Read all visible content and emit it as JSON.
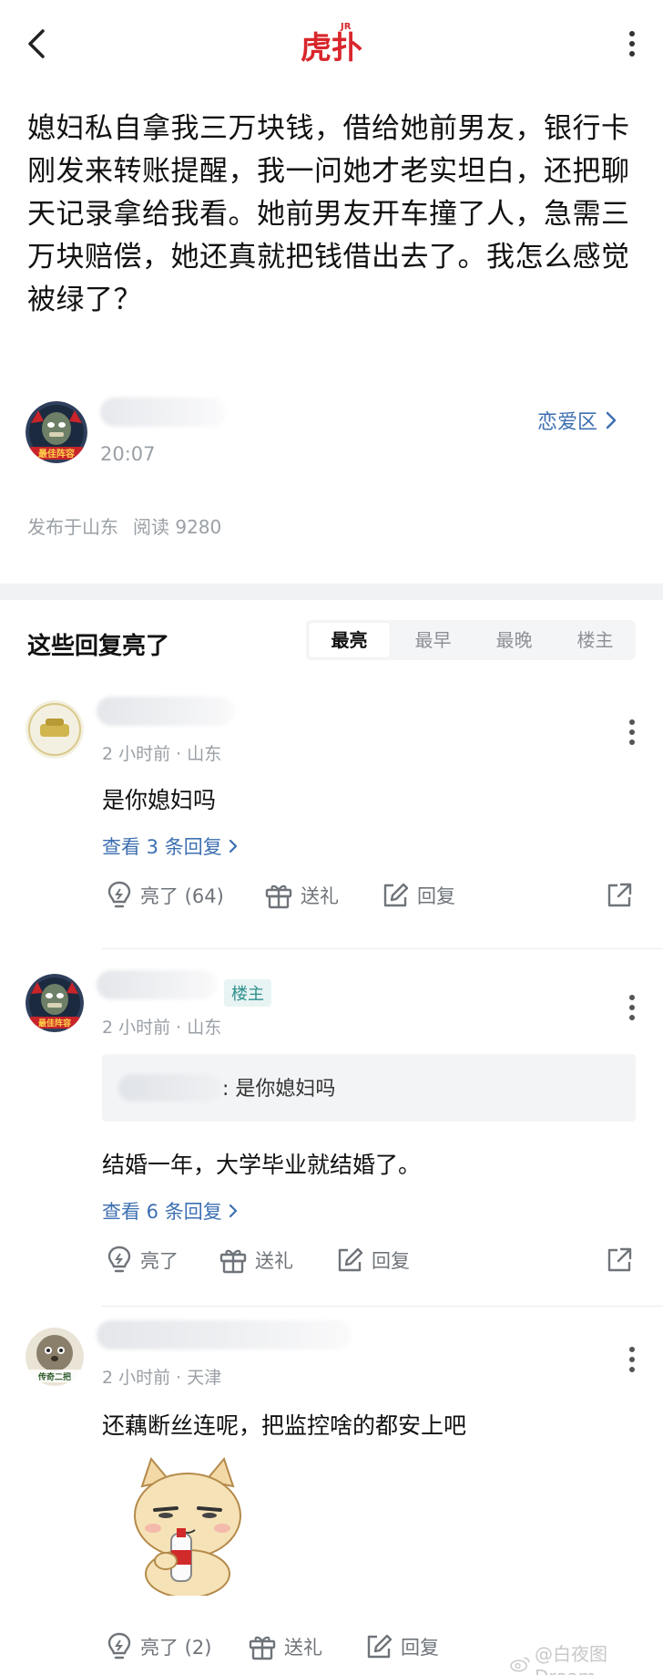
{
  "app": {
    "logo_text": "虎扑",
    "logo_badge": "JR"
  },
  "post": {
    "title": "媳妇私自拿我三万块钱，借给她前男友，银行卡刚发来转账提醒，我一问她才老实坦白，还把聊天记录拿给我看。她前男友开车撞了人，急需三万块赔偿，她还真就把钱借出去了。我怎么感觉被绿了？",
    "author_time": "20:07",
    "author_avatar_caption": "最佳阵容",
    "section": "恋爱区",
    "location": "发布于山东",
    "read_count": "阅读 9280"
  },
  "replies": {
    "title": "这些回复亮了",
    "sort_tabs": [
      "最亮",
      "最早",
      "最晚",
      "楼主"
    ],
    "active_tab": "最亮"
  },
  "comments": [
    {
      "meta": "2 小时前 · 山东",
      "text": "是你媳妇吗",
      "more_replies": "查看 3 条回复",
      "likes": "亮了 (64)",
      "gift": "送礼",
      "reply": "回复"
    },
    {
      "badge": "楼主",
      "meta": "2 小时前 · 山东",
      "quote": ": 是你媳妇吗",
      "text": "结婚一年，大学毕业就结婚了。",
      "more_replies": "查看 6 条回复",
      "likes": "亮了",
      "gift": "送礼",
      "reply": "回复"
    },
    {
      "meta": "2 小时前 · 天津",
      "text": "还藕断丝连呢，把监控啥的都安上吧",
      "avatar_caption": "传奇二把",
      "likes": "亮了 (2)",
      "gift": "送礼",
      "reply": "回复"
    }
  ],
  "watermark": "@白夜图Dream",
  "colors": {
    "accent": "#3d6fb1",
    "logo_red": "#d9262b",
    "op_badge": "#2f8f8b",
    "muted": "#9aa0a6"
  },
  "icons": [
    "back-arrow-icon",
    "more-vertical-icon",
    "chevron-right-icon",
    "like-bulb-icon",
    "gift-icon",
    "reply-pencil-icon",
    "share-icon"
  ]
}
